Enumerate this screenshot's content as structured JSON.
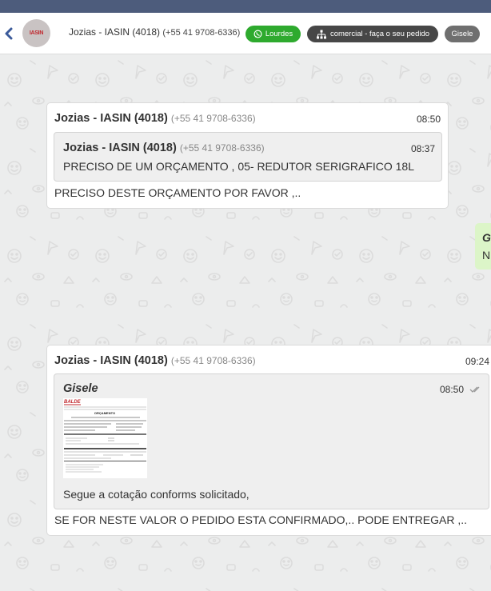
{
  "header": {
    "avatar_logo": "IASIN",
    "contact_name": "Jozias - IASIN (4018)",
    "contact_phone": "(+55 41 9708-6336)",
    "tags": [
      {
        "label": "Lourdes",
        "icon": "whatsapp-icon",
        "color": "#2eaa2e"
      },
      {
        "label": "comercial - faça o seu pedido",
        "icon": "org-chart-icon",
        "color": "#474747"
      },
      {
        "label": "Gisele",
        "color": "#6f6f6f"
      }
    ]
  },
  "messages": [
    {
      "sender": "Jozias - IASIN (4018)",
      "phone": "(+55 41 9708-6336)",
      "time": "08:50",
      "quoted": {
        "sender": "Jozias - IASIN (4018)",
        "phone": "(+55 41 9708-6336)",
        "time": "08:37",
        "text": "PRECISO DE UM ORÇAMENTO , 05- REDUTOR SERIGRAFICO 18L"
      },
      "text": "PRECISO DESTE ORÇAMENTO POR FAVOR ,.."
    },
    {
      "sender": "Jozias - IASIN (4018)",
      "phone": "(+55 41 9708-6336)",
      "time": "09:24",
      "quoted": {
        "sender": "Gisele",
        "time": "08:50",
        "attachment_logo": "BALDE",
        "attachment_title": "ORÇAMENTO",
        "text": "Segue a cotação conforms solicitado,"
      },
      "text": "SE FOR NESTE VALOR O PEDIDO ESTA CONFIRMADO,.. PODE ENTREGAR ,.."
    }
  ],
  "partial_bubble": {
    "line1": "G",
    "line2": "N"
  }
}
